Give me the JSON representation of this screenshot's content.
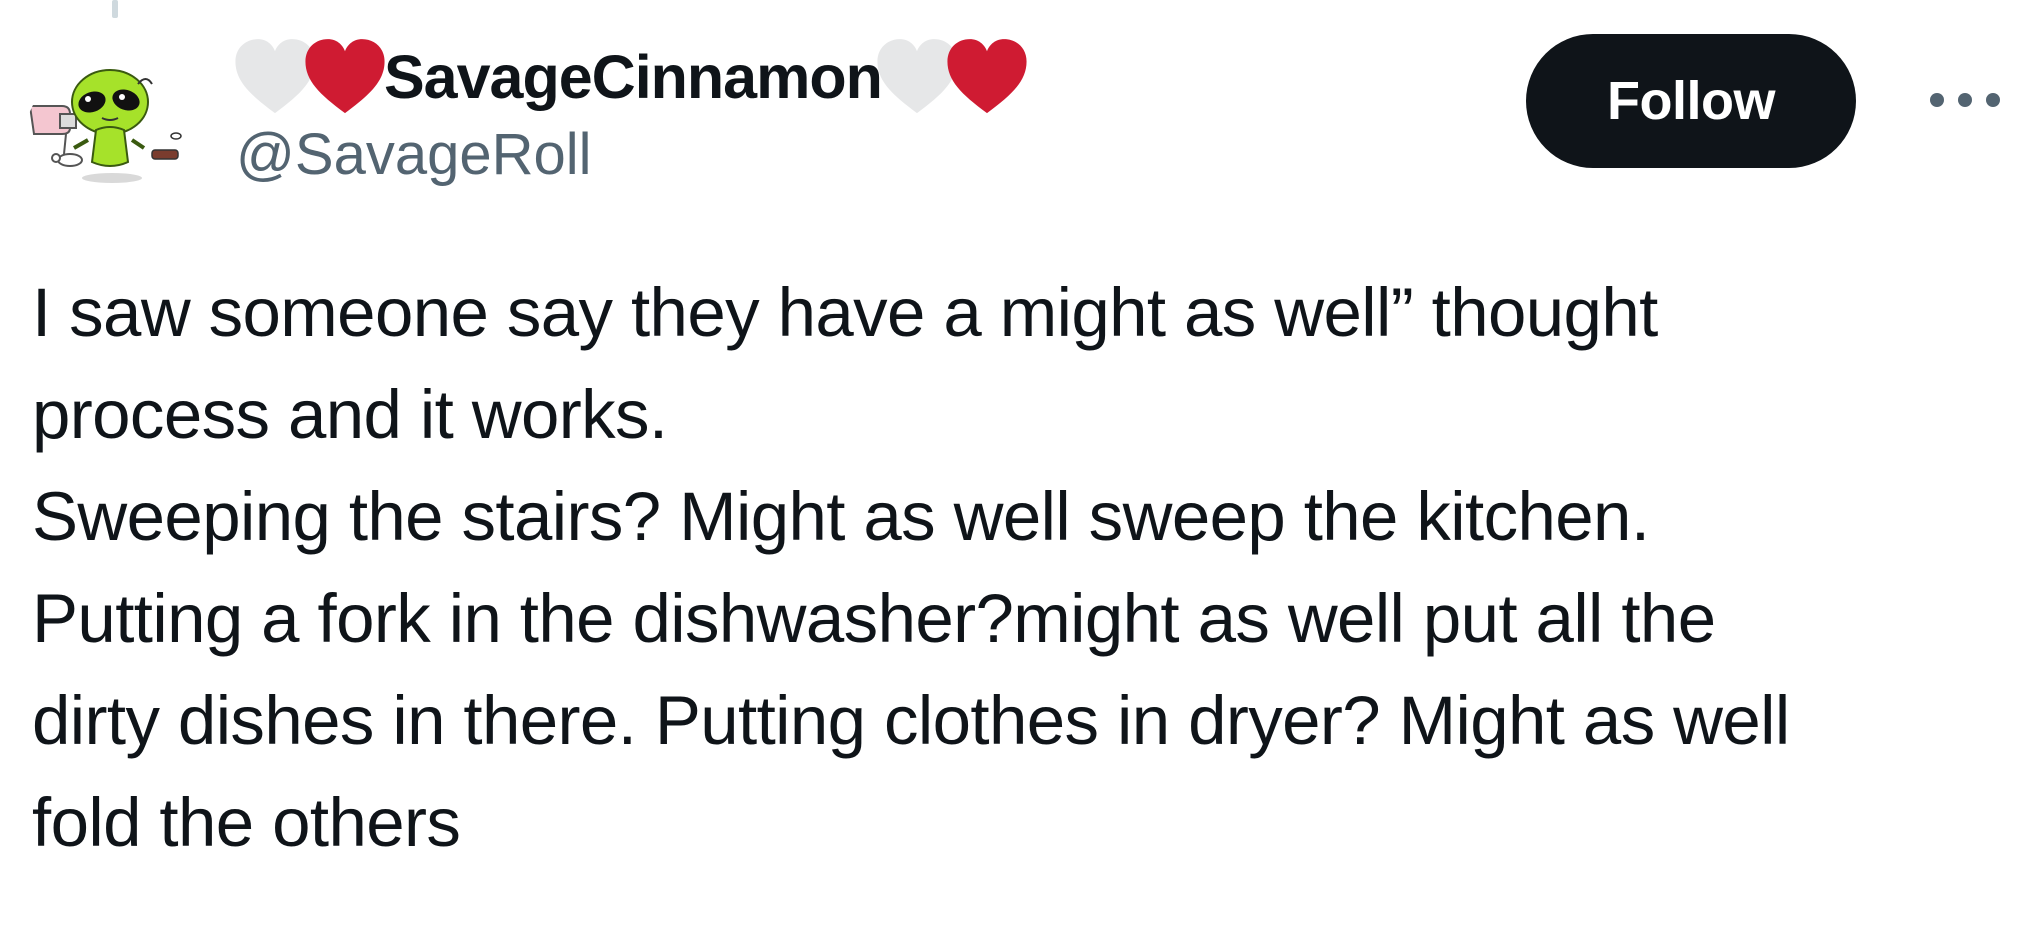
{
  "author": {
    "display_name": "SavageCinnamon",
    "handle": "@SavageRoll",
    "name_decorations": [
      "white-heart-icon",
      "red-heart-icon",
      "white-heart-icon",
      "red-heart-icon"
    ]
  },
  "actions": {
    "follow_label": "Follow",
    "more_icon": "more-horizontal-icon"
  },
  "tweet": {
    "lines": [
      "I saw someone say they have a might as well” thought",
      "process and it works.",
      "Sweeping the stairs? Might as well sweep the kitchen.",
      "Putting a fork in the dishwasher?might as well put all the",
      "dirty dishes in there. Putting clothes in dryer? Might as well",
      "fold the others"
    ]
  },
  "colors": {
    "text_primary": "#0f1419",
    "text_secondary": "#536471",
    "follow_bg": "#0f1419",
    "heart_red": "#cf1b32",
    "heart_white": "#e6e7e8",
    "avatar_green": "#a6e22a"
  }
}
